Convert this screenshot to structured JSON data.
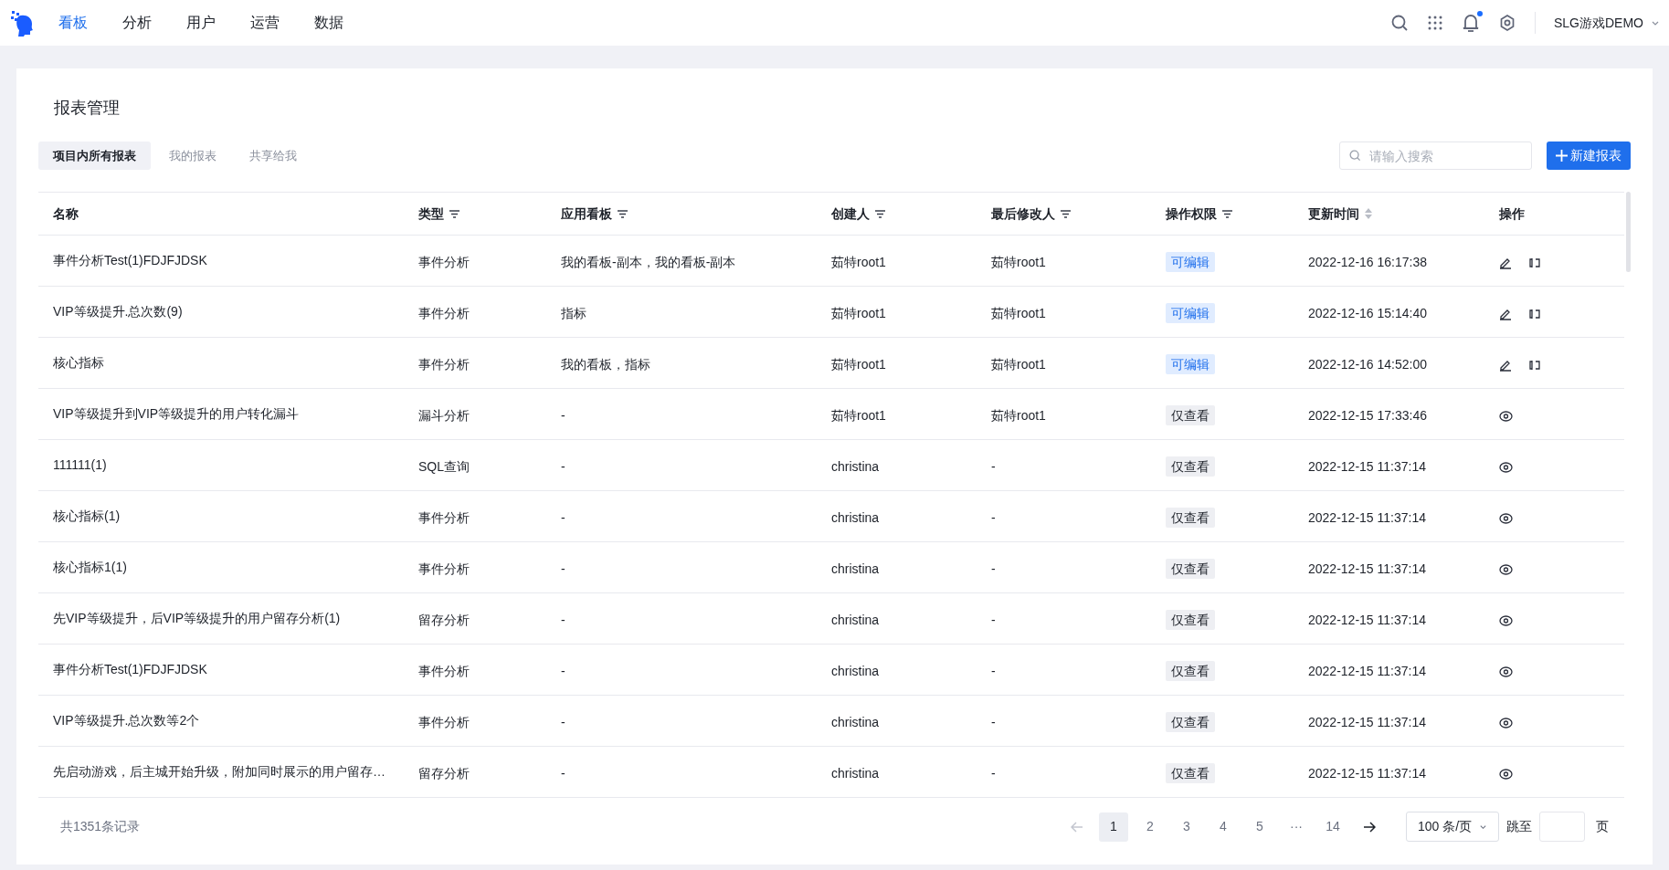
{
  "nav": {
    "items": [
      {
        "label": "看板",
        "selected": true
      },
      {
        "label": "分析",
        "selected": false
      },
      {
        "label": "用户",
        "selected": false
      },
      {
        "label": "运营",
        "selected": false
      },
      {
        "label": "数据",
        "selected": false
      }
    ],
    "notification_dot": true,
    "project": "SLG游戏DEMO"
  },
  "page": {
    "title": "报表管理"
  },
  "tabs": [
    {
      "label": "项目内所有报表",
      "selected": true
    },
    {
      "label": "我的报表",
      "selected": false
    },
    {
      "label": "共享给我",
      "selected": false
    }
  ],
  "search": {
    "placeholder": "请输入搜索"
  },
  "new_button": "新建报表",
  "table": {
    "columns": [
      {
        "label": "名称",
        "kind": "plain"
      },
      {
        "label": "类型",
        "kind": "filter"
      },
      {
        "label": "应用看板",
        "kind": "filter"
      },
      {
        "label": "创建人",
        "kind": "filter"
      },
      {
        "label": "最后修改人",
        "kind": "filter"
      },
      {
        "label": "操作权限",
        "kind": "filter"
      },
      {
        "label": "更新时间",
        "kind": "sort"
      },
      {
        "label": "操作",
        "kind": "plain"
      }
    ],
    "rows": [
      {
        "name": "事件分析Test(1)FDJFJDSK",
        "type": "事件分析",
        "boards": "我的看板-副本，我的看板-副本",
        "creator": "茹特root1",
        "modifier": "茹特root1",
        "permission": {
          "text": "可编辑",
          "kind": "edit"
        },
        "updated": "2022-12-16 16:17:38",
        "actions": [
          {
            "kind": "edit"
          },
          {
            "kind": "share"
          }
        ]
      },
      {
        "name": "VIP等级提升.总次数(9)",
        "type": "事件分析",
        "boards": "指标",
        "creator": "茹特root1",
        "modifier": "茹特root1",
        "permission": {
          "text": "可编辑",
          "kind": "edit"
        },
        "updated": "2022-12-16 15:14:40",
        "actions": [
          {
            "kind": "edit"
          },
          {
            "kind": "share"
          }
        ]
      },
      {
        "name": "核心指标",
        "type": "事件分析",
        "boards": "我的看板，指标",
        "creator": "茹特root1",
        "modifier": "茹特root1",
        "permission": {
          "text": "可编辑",
          "kind": "edit"
        },
        "updated": "2022-12-16 14:52:00",
        "actions": [
          {
            "kind": "edit"
          },
          {
            "kind": "share"
          }
        ]
      },
      {
        "name": "VIP等级提升到VIP等级提升的用户转化漏斗",
        "type": "漏斗分析",
        "boards": "-",
        "creator": "茹特root1",
        "modifier": "茹特root1",
        "permission": {
          "text": "仅查看",
          "kind": "view"
        },
        "updated": "2022-12-15 17:33:46",
        "actions": [
          {
            "kind": "view"
          }
        ]
      },
      {
        "name": "111111(1)",
        "type": "SQL查询",
        "boards": "-",
        "creator": "christina",
        "modifier": "-",
        "permission": {
          "text": "仅查看",
          "kind": "view"
        },
        "updated": "2022-12-15 11:37:14",
        "actions": [
          {
            "kind": "view"
          }
        ]
      },
      {
        "name": "核心指标(1)",
        "type": "事件分析",
        "boards": "-",
        "creator": "christina",
        "modifier": "-",
        "permission": {
          "text": "仅查看",
          "kind": "view"
        },
        "updated": "2022-12-15 11:37:14",
        "actions": [
          {
            "kind": "view"
          }
        ]
      },
      {
        "name": "核心指标1(1)",
        "type": "事件分析",
        "boards": "-",
        "creator": "christina",
        "modifier": "-",
        "permission": {
          "text": "仅查看",
          "kind": "view"
        },
        "updated": "2022-12-15 11:37:14",
        "actions": [
          {
            "kind": "view"
          }
        ]
      },
      {
        "name": "先VIP等级提升，后VIP等级提升的用户留存分析(1)",
        "type": "留存分析",
        "boards": "-",
        "creator": "christina",
        "modifier": "-",
        "permission": {
          "text": "仅查看",
          "kind": "view"
        },
        "updated": "2022-12-15 11:37:14",
        "actions": [
          {
            "kind": "view"
          }
        ]
      },
      {
        "name": "事件分析Test(1)FDJFJDSK",
        "type": "事件分析",
        "boards": "-",
        "creator": "christina",
        "modifier": "-",
        "permission": {
          "text": "仅查看",
          "kind": "view"
        },
        "updated": "2022-12-15 11:37:14",
        "actions": [
          {
            "kind": "view"
          }
        ]
      },
      {
        "name": "VIP等级提升.总次数等2个",
        "type": "事件分析",
        "boards": "-",
        "creator": "christina",
        "modifier": "-",
        "permission": {
          "text": "仅查看",
          "kind": "view"
        },
        "updated": "2022-12-15 11:37:14",
        "actions": [
          {
            "kind": "view"
          }
        ]
      },
      {
        "name": "先启动游戏，后主城开始升级，附加同时展示的用户留存…",
        "type": "留存分析",
        "boards": "-",
        "creator": "christina",
        "modifier": "-",
        "permission": {
          "text": "仅查看",
          "kind": "view"
        },
        "updated": "2022-12-15 11:37:14",
        "actions": [
          {
            "kind": "view"
          }
        ]
      }
    ]
  },
  "pagination": {
    "total": "共1351条记录",
    "prev_disabled": true,
    "pages": [
      {
        "label": "1",
        "selected": true
      },
      {
        "label": "2",
        "selected": false
      },
      {
        "label": "3",
        "selected": false
      },
      {
        "label": "4",
        "selected": false
      },
      {
        "label": "5",
        "selected": false
      },
      {
        "label": "···",
        "selected": false
      },
      {
        "label": "14",
        "selected": false
      }
    ],
    "page_size": "100 条/页",
    "jump_label": "跳至",
    "page_suffix": "页"
  }
}
